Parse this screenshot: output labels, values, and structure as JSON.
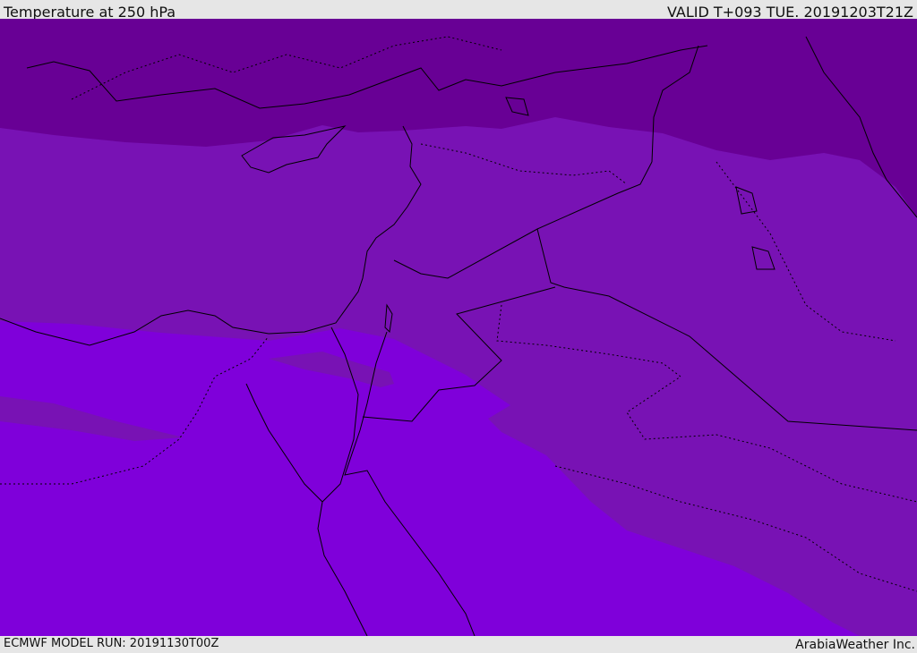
{
  "header": {
    "title": "Temperature at 250 hPa",
    "valid": "VALID T+093 TUE. 20191203T21Z"
  },
  "footer": {
    "model_run": "ECMWF MODEL RUN: 20191130T00Z",
    "credit": "ArabiaWeather Inc."
  },
  "colors": {
    "band_cold": "#680095",
    "band_mid": "#7812b4",
    "band_warm": "#7f00da",
    "coastline": "#000000",
    "background": "#e6e6e6"
  }
}
